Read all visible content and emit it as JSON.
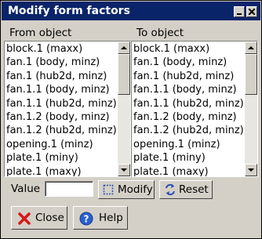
{
  "window": {
    "title": "Modify form factors"
  },
  "lists": {
    "from_header": "From object",
    "to_header": "To object",
    "from_items": [
      "block.1 (maxx)",
      "fan.1 (body, minz)",
      "fan.1 (hub2d, minz)",
      "fan.1.1 (body, minz)",
      "fan.1.1 (hub2d, minz)",
      "fan.1.2 (body, minz)",
      "fan.1.2 (hub2d, minz)",
      "opening.1 (minz)",
      "plate.1 (miny)",
      "plate.1 (maxy)"
    ],
    "to_items": [
      "block.1 (maxx)",
      "fan.1 (body, minz)",
      "fan.1 (hub2d, minz)",
      "fan.1.1 (body, minz)",
      "fan.1.1 (hub2d, minz)",
      "fan.1.2 (body, minz)",
      "fan.1.2 (hub2d, minz)",
      "opening.1 (minz)",
      "plate.1 (miny)",
      "plate.1 (maxy)"
    ]
  },
  "value": {
    "label": "Value",
    "current": ""
  },
  "buttons": {
    "modify": "Modify",
    "reset": "Reset",
    "close": "Close",
    "help": "Help"
  },
  "icons": {
    "minimize": "minimize-icon",
    "close_window": "close-icon",
    "modify": "select-box-icon",
    "reset": "reset-arrows-icon",
    "close": "red-x-icon",
    "help": "help-question-icon"
  },
  "colors": {
    "titlebar": "#0a246a",
    "face": "#d4d0c8",
    "list_bg": "#ffffff"
  }
}
